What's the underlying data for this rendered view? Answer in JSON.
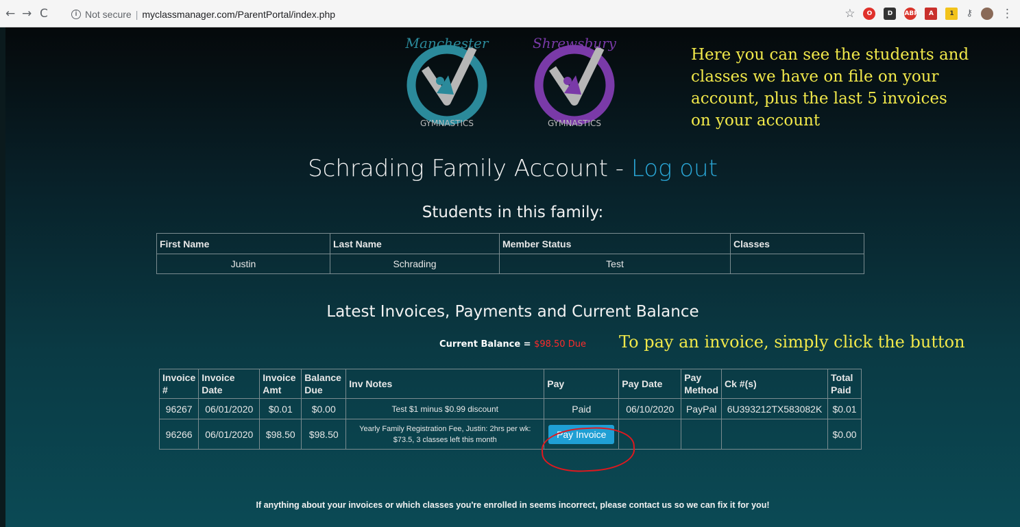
{
  "browser": {
    "security_label": "Not secure",
    "url": "myclassmanager.com/ParentPortal/index.php"
  },
  "logos": {
    "left": {
      "script_text": "Manchester",
      "arc_text": "GYMNASTICS",
      "ring_color": "#2b8a9b"
    },
    "right": {
      "script_text": "Shrewsbury",
      "arc_text": "GYMNASTICS",
      "ring_color": "#7a3aa8"
    }
  },
  "annotations": {
    "top_note": [
      "Here you can see the students and",
      "classes we have on file on your",
      "account, plus the last 5 invoices",
      "on your account"
    ],
    "pay_note": "To pay an invoice, simply click the button"
  },
  "account": {
    "title": "Schrading Family Account - ",
    "logout": "Log out"
  },
  "students": {
    "heading": "Students in this family:",
    "columns": [
      "First Name",
      "Last Name",
      "Member Status",
      "Classes"
    ],
    "rows": [
      [
        "Justin",
        "Schrading",
        "Test",
        ""
      ]
    ]
  },
  "invoices": {
    "heading": "Latest Invoices, Payments and Current Balance",
    "balance_label": "Current Balance = ",
    "balance_value": "$98.50 Due",
    "columns": [
      "Invoice #",
      "Invoice Date",
      "Invoice Amt",
      "Balance Due",
      "Inv Notes",
      "Pay",
      "Pay Date",
      "Pay Method",
      "Ck #(s)",
      "Total Paid"
    ],
    "rows": [
      {
        "number": "96267",
        "date": "06/01/2020",
        "amt": "$0.01",
        "balance": "$0.00",
        "notes": "Test $1 minus $0.99 discount",
        "pay": "Paid",
        "pay_date": "06/10/2020",
        "method": "PayPal",
        "check": "6U393212TX583082K",
        "total": "$0.01"
      },
      {
        "number": "96266",
        "date": "06/01/2020",
        "amt": "$98.50",
        "balance": "$98.50",
        "notes": "Yearly Family Registration Fee, Justin: 2hrs per wk: $73.5, 3 classes left this month",
        "pay": "Pay Invoice",
        "pay_date": "",
        "method": "",
        "check": "",
        "total": "$0.00"
      }
    ]
  },
  "footer": "If anything about your invoices or which classes you're enrolled in seems incorrect, please contact us so we can fix it for you!"
}
